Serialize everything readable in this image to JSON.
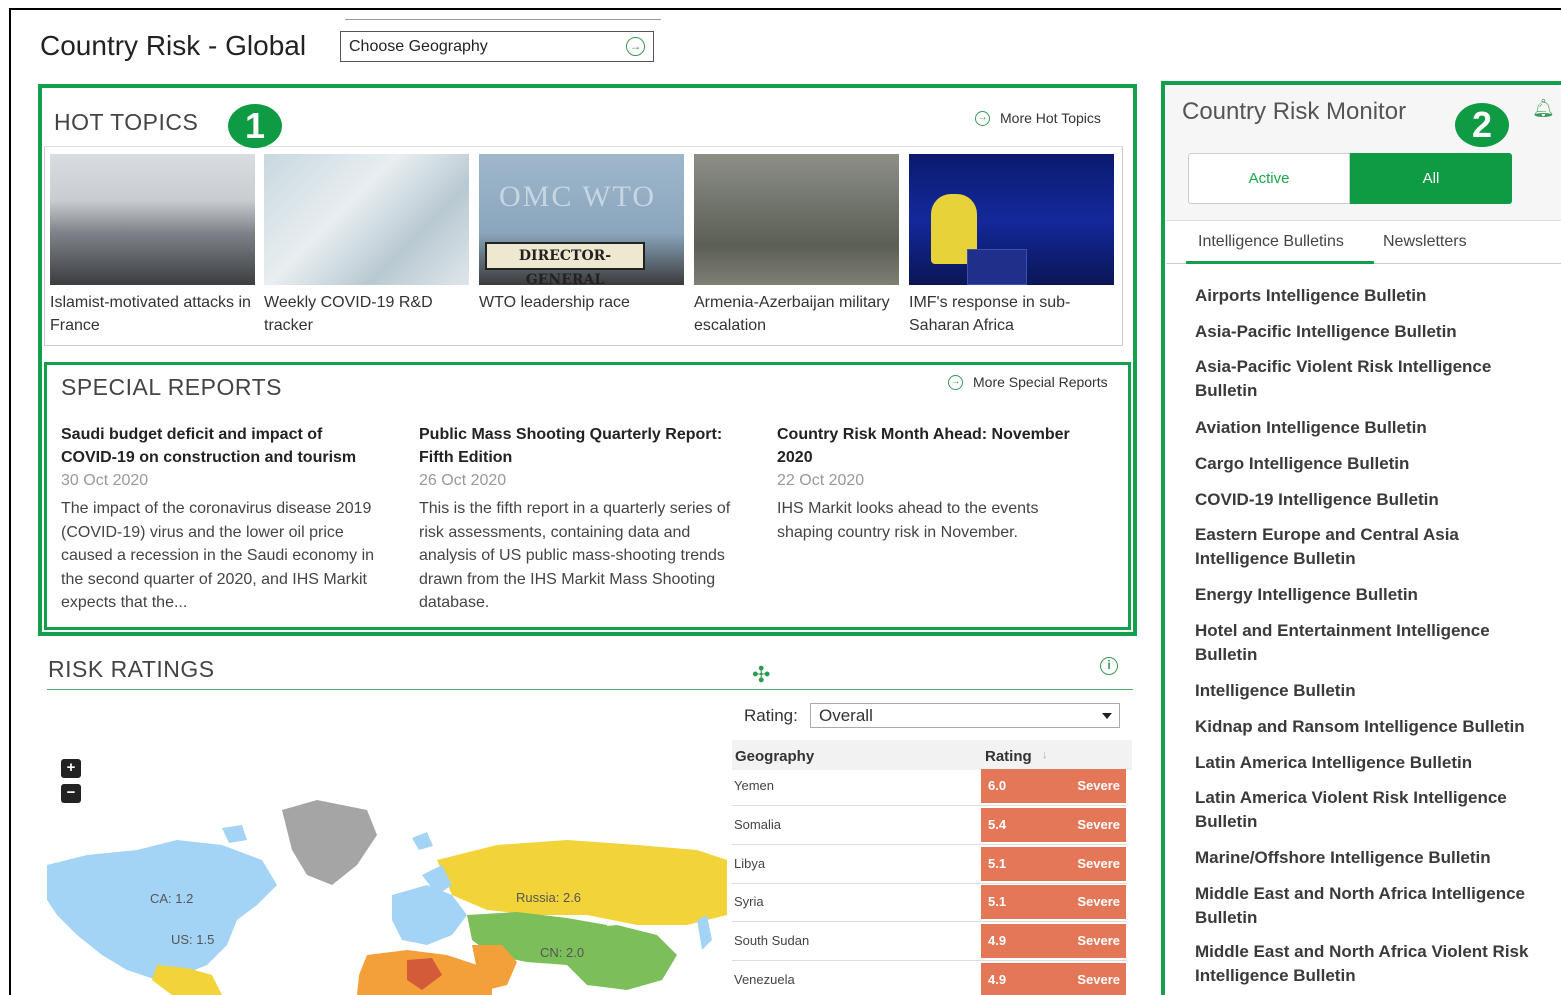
{
  "header": {
    "title": "Country Risk - Global",
    "geography_placeholder": "Choose Geography"
  },
  "badges": {
    "one": "1",
    "two": "2"
  },
  "hot_topics": {
    "title": "HOT TOPICS",
    "more_label": "More Hot Topics",
    "items": [
      {
        "caption": "Islamist-motivated attacks in France"
      },
      {
        "caption": "Weekly COVID-19 R&D tracker"
      },
      {
        "caption": "WTO leadership race"
      },
      {
        "caption": "Armenia-Azerbaijan military escalation"
      },
      {
        "caption": "IMF's response in sub-Saharan Africa"
      }
    ],
    "wto_image_text": "DIRECTOR-GENERAL",
    "wto_bg_text": "OMC WTO"
  },
  "special_reports": {
    "title": "SPECIAL REPORTS",
    "more_label": "More Special Reports",
    "items": [
      {
        "title": "Saudi budget deficit and impact of COVID-19 on construction and tourism",
        "date": "30 Oct 2020",
        "body": "The impact of the coronavirus disease 2019 (COVID-19) virus and the lower oil price caused a recession in the Saudi economy in the second quarter of 2020, and IHS Markit expects that the..."
      },
      {
        "title": "Public Mass Shooting Quarterly Report: Fifth Edition",
        "date": "26 Oct 2020",
        "body": "This is the fifth report in a quarterly series of risk assessments, containing data and analysis of US public mass-shooting trends drawn from the IHS Markit Mass Shooting database."
      },
      {
        "title": "Country Risk Month Ahead: November 2020",
        "date": "22 Oct 2020",
        "body": "IHS Markit looks ahead to the events shaping country risk in November."
      }
    ]
  },
  "risk_ratings": {
    "title": "RISK RATINGS",
    "rating_label": "Rating:",
    "rating_value": "Overall",
    "col_geography": "Geography",
    "col_rating": "Rating",
    "zoom_in": "+",
    "zoom_out": "−",
    "map_labels": {
      "ca": "CA: 1.2",
      "us": "US: 1.5",
      "russia": "Russia: 2.6",
      "cn": "CN: 2.0"
    },
    "rows": [
      {
        "geography": "Yemen",
        "score": "6.0",
        "level": "Severe"
      },
      {
        "geography": "Somalia",
        "score": "5.4",
        "level": "Severe"
      },
      {
        "geography": "Libya",
        "score": "5.1",
        "level": "Severe"
      },
      {
        "geography": "Syria",
        "score": "5.1",
        "level": "Severe"
      },
      {
        "geography": "South Sudan",
        "score": "4.9",
        "level": "Severe"
      },
      {
        "geography": "Venezuela",
        "score": "4.9",
        "level": "Severe"
      }
    ],
    "severe_color": "#e37757"
  },
  "monitor": {
    "title": "Country Risk Monitor",
    "toggle_active": "Active",
    "toggle_all": "All",
    "tab_bulletins": "Intelligence Bulletins",
    "tab_newsletters": "Newsletters",
    "bulletins": [
      "Airports Intelligence Bulletin",
      "Asia-Pacific Intelligence Bulletin",
      "Asia-Pacific Violent Risk Intelligence Bulletin",
      "Aviation Intelligence Bulletin",
      "Cargo Intelligence Bulletin",
      "COVID-19 Intelligence Bulletin",
      "Eastern Europe and Central Asia Intelligence Bulletin",
      "Energy Intelligence Bulletin",
      "Hotel and Entertainment Intelligence Bulletin",
      "Intelligence Bulletin",
      "Kidnap and Ransom Intelligence Bulletin",
      "Latin America Intelligence Bulletin",
      "Latin America Violent Risk Intelligence Bulletin",
      "Marine/Offshore Intelligence Bulletin",
      "Middle East and North Africa Intelligence Bulletin",
      "Middle East and North Africa Violent Risk Intelligence Bulletin"
    ],
    "accent_color": "#0f9a44"
  }
}
